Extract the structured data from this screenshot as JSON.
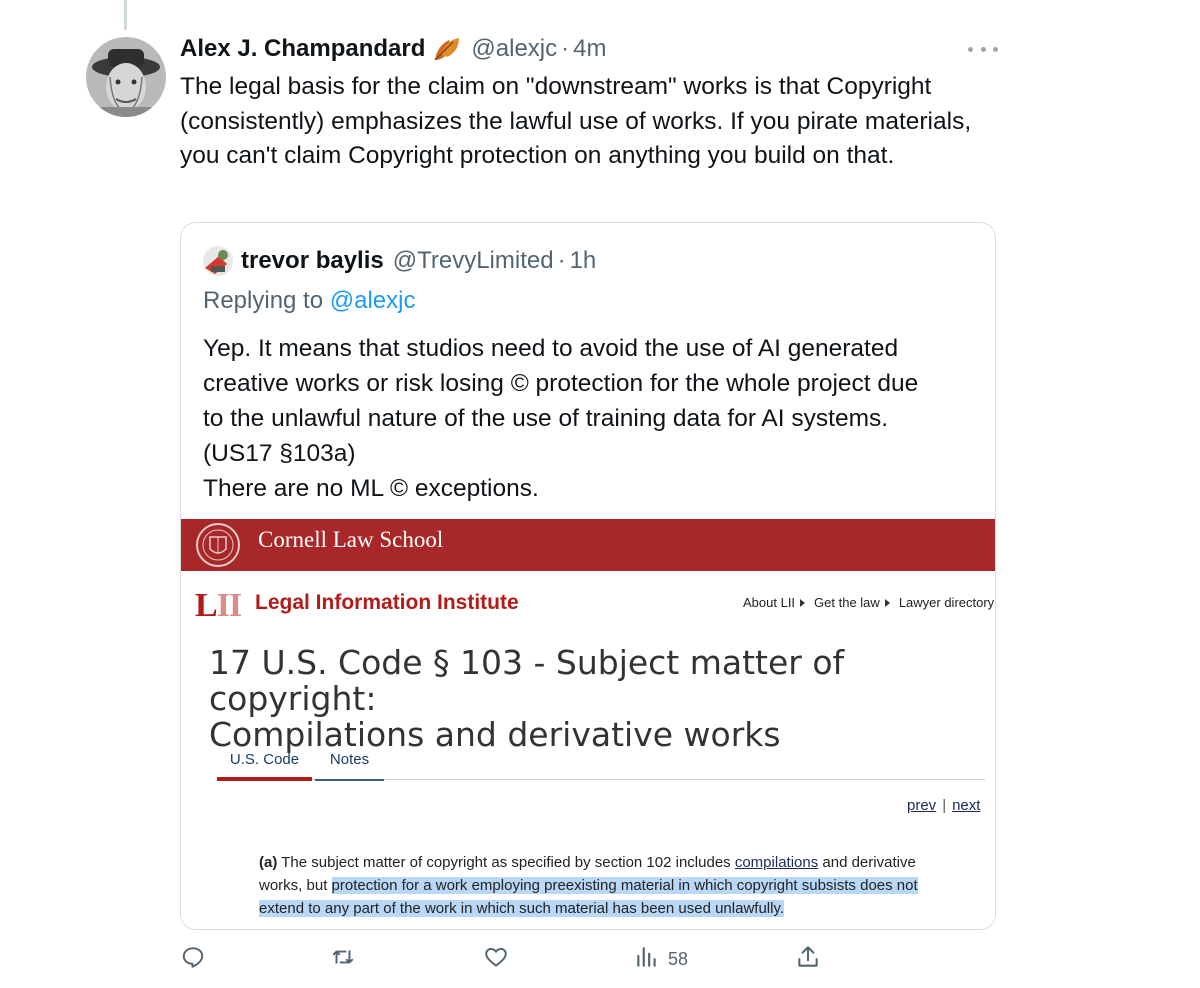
{
  "tweet": {
    "author_name": "Alex J. Champandard",
    "handle": "@alexjc",
    "separator": "·",
    "time": "4m",
    "text": "The legal basis for the claim on \"downstream\" works is that Copyright (consistently) emphasizes the lawful use of works.  If you pirate materials, you can't claim Copyright protection on anything you build on that.",
    "name_icon": "autumn-leaf-icon",
    "more_icon": "more-dots-icon"
  },
  "quote": {
    "author_name": "trevor baylis",
    "handle": "@TrevyLimited",
    "separator": "·",
    "time": "1h",
    "replying_prefix": "Replying to",
    "replying_handle": "@alexjc",
    "text_lines": [
      "Yep. It means that studios need to avoid the use of AI generated",
      "creative works or risk losing © protection for the whole project due",
      "to the unlawful nature of the use of training data for AI systems.",
      "(US17 §103a)",
      "There are no ML © exceptions."
    ],
    "embed": {
      "school_name": "Cornell Law School",
      "lii_logo": "LII",
      "lii_name": "Legal Information Institute",
      "nav": [
        "About LII",
        "Get the law",
        "Lawyer directory"
      ],
      "title_line1": "17 U.S. Code § 103 - Subject matter of copyright:",
      "title_line2": "Compilations and derivative works",
      "tabs": [
        "U.S. Code",
        "Notes"
      ],
      "prev": "prev",
      "next": "next",
      "prevnext_sep": "|",
      "law": {
        "label": "(a)",
        "part1": "The subject matter of copyright as specified by section 102 includes",
        "link": "compilations",
        "part2": "and derivative works, but",
        "highlight": "protection for a work employing preexisting material in which copyright subsists does not extend to any part of the work in which such material has been used unlawfully."
      },
      "colors": {
        "cornell_red": "#a8282a",
        "highlight": "#b9d7f7"
      }
    }
  },
  "actions": {
    "reply_icon": "reply-icon",
    "retweet_icon": "retweet-icon",
    "like_icon": "like-heart-icon",
    "views_icon": "views-chart-icon",
    "views_count": "58",
    "share_icon": "share-icon"
  },
  "colors": {
    "text": "#0f1419",
    "secondary": "#536471",
    "link": "#1d9bf0",
    "border": "#d6dde2"
  }
}
